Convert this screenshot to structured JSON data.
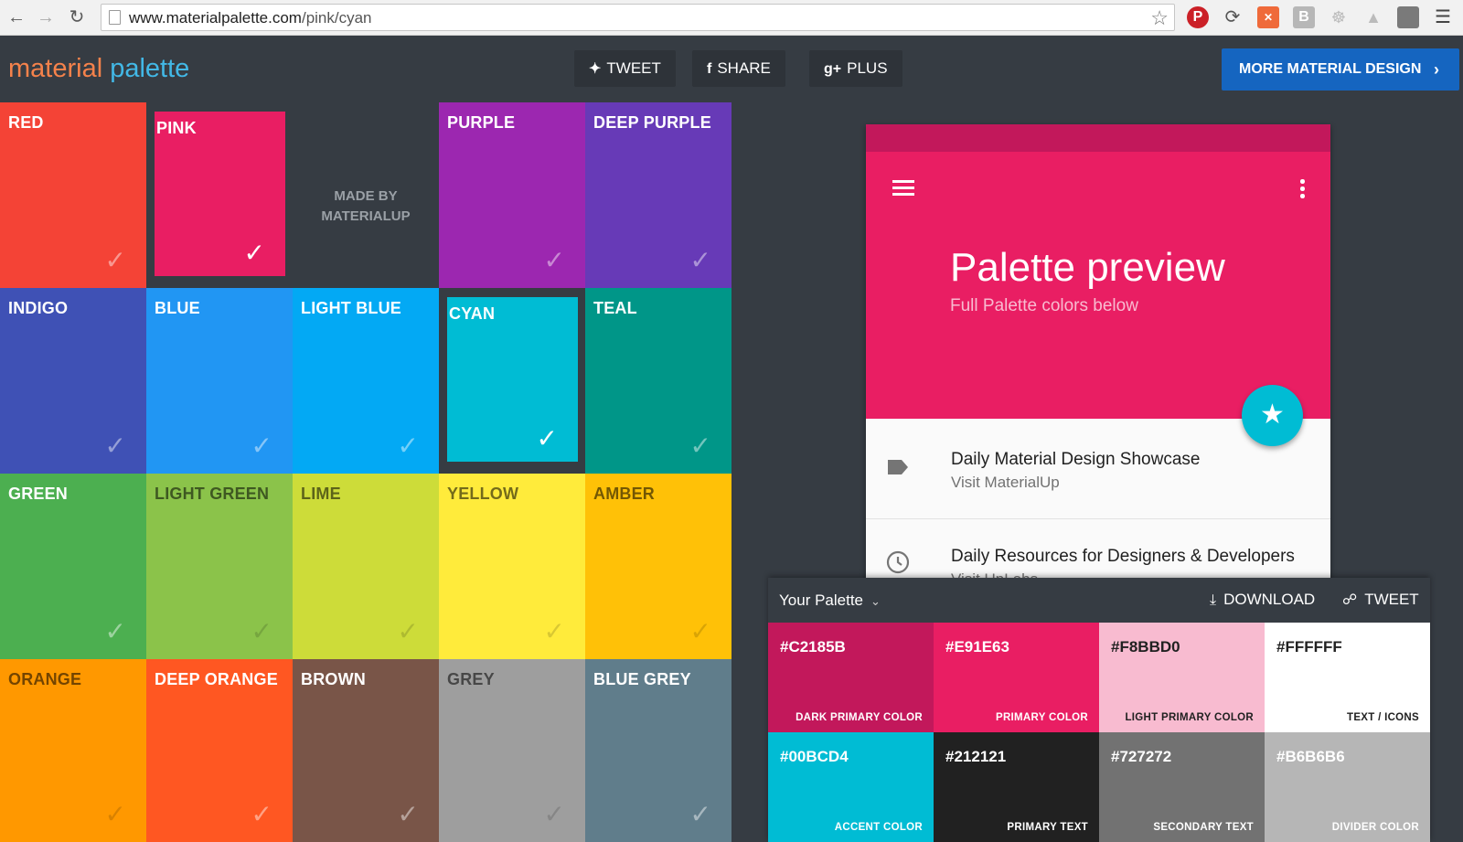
{
  "browser": {
    "url_host": "www.materialpalette.com",
    "url_path": "/pink/cyan"
  },
  "header": {
    "logo_part1": "material",
    "logo_part2": "palette",
    "tweet_label": "TWEET",
    "share_label": "SHARE",
    "plus_label": "PLUS",
    "more_label": "MORE MATERIAL DESIGN"
  },
  "grid": {
    "tiles": [
      {
        "name": "RED",
        "color": "#f44336"
      },
      {
        "name": "PINK",
        "color": "#e91e63"
      },
      {
        "name": "PURPLE",
        "color": "#9c27b0"
      },
      {
        "name": "DEEP PURPLE",
        "color": "#673ab7"
      },
      {
        "name": "INDIGO",
        "color": "#3f51b5"
      },
      {
        "name": "BLUE",
        "color": "#2196f3"
      },
      {
        "name": "LIGHT BLUE",
        "color": "#03a9f4"
      },
      {
        "name": "CYAN",
        "color": "#00bcd4"
      },
      {
        "name": "TEAL",
        "color": "#009688"
      },
      {
        "name": "GREEN",
        "color": "#4caf50"
      },
      {
        "name": "LIGHT GREEN",
        "color": "#8bc34a"
      },
      {
        "name": "LIME",
        "color": "#cddc39"
      },
      {
        "name": "YELLOW",
        "color": "#ffeb3b"
      },
      {
        "name": "AMBER",
        "color": "#ffc107"
      },
      {
        "name": "ORANGE",
        "color": "#ff9800"
      },
      {
        "name": "DEEP ORANGE",
        "color": "#ff5722"
      },
      {
        "name": "BROWN",
        "color": "#795548"
      },
      {
        "name": "GREY",
        "color": "#9e9e9e"
      },
      {
        "name": "BLUE GREY",
        "color": "#607d8b"
      }
    ],
    "made_by_line1": "MADE BY",
    "made_by_line2": "MATERIALUP"
  },
  "preview": {
    "title": "Palette preview",
    "subtitle": "Full Palette colors below",
    "items": [
      {
        "title": "Daily Material Design Showcase",
        "subtitle": "Visit MaterialUp"
      },
      {
        "title": "Daily Resources for Designers & Developers",
        "subtitle": "Visit UpLabs"
      }
    ]
  },
  "palette": {
    "title": "Your Palette",
    "download_label": "DOWNLOAD",
    "tweet_label": "TWEET",
    "swatches": [
      {
        "hex": "#C2185B",
        "label": "DARK PRIMARY COLOR"
      },
      {
        "hex": "#E91E63",
        "label": "PRIMARY COLOR"
      },
      {
        "hex": "#F8BBD0",
        "label": "LIGHT PRIMARY COLOR"
      },
      {
        "hex": "#FFFFFF",
        "label": "TEXT / ICONS"
      },
      {
        "hex": "#00BCD4",
        "label": "ACCENT COLOR"
      },
      {
        "hex": "#212121",
        "label": "PRIMARY TEXT"
      },
      {
        "hex": "#727272",
        "label": "SECONDARY TEXT"
      },
      {
        "hex": "#B6B6B6",
        "label": "DIVIDER COLOR"
      }
    ]
  }
}
